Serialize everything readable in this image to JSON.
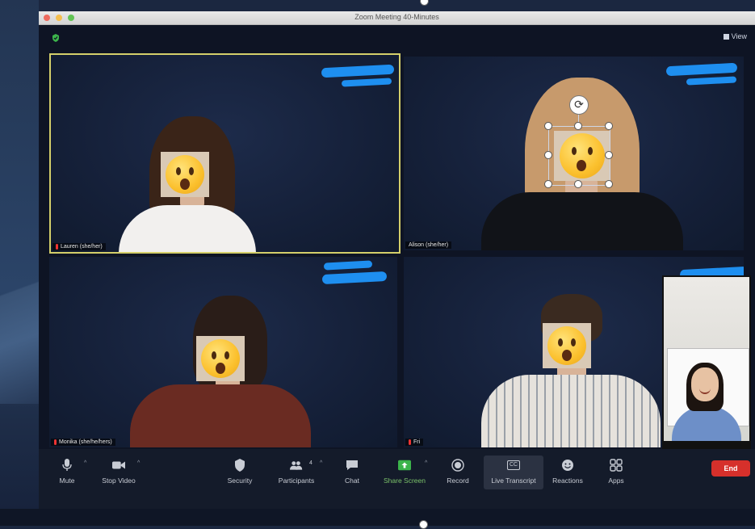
{
  "window": {
    "title": "Zoom Meeting   40-Minutes"
  },
  "header": {
    "view_label": "View"
  },
  "participants": [
    {
      "name": "Lauren  (she/her)"
    },
    {
      "name": "Alison  (she/her)"
    },
    {
      "name": "Monika  (she/he/hers)"
    },
    {
      "name": "Fri"
    }
  ],
  "toolbar": {
    "mute": "Mute",
    "stop_video": "Stop Video",
    "security": "Security",
    "participants": "Participants",
    "participants_count": "4",
    "chat": "Chat",
    "share_screen": "Share Screen",
    "record": "Record",
    "live_transcript": "Live Transcript",
    "cc_icon": "CC",
    "reactions": "Reactions",
    "apps": "Apps",
    "end": "End"
  },
  "colors": {
    "active_speaker_border": "#d4cf6a",
    "end_button": "#d6302b",
    "share_screen": "#7cc36a",
    "redaction_scribble": "#1e8ff0"
  },
  "icons": {
    "face_overlay": "astonished-face-emoji"
  }
}
